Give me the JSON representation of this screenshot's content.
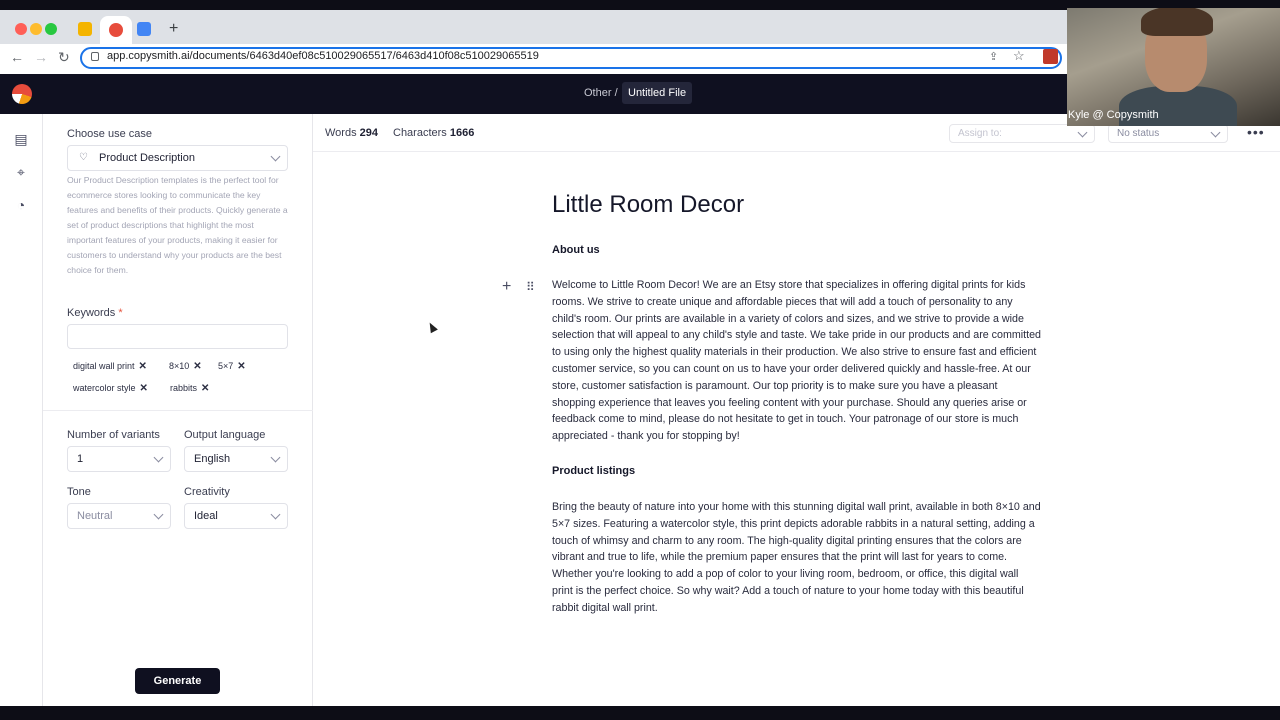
{
  "browser": {
    "url": "app.copysmith.ai/documents/6463d40ef08c510029065517/6463d410f08c510029065519"
  },
  "header": {
    "breadcrumb_parent": "Other /",
    "file_name": "Untitled File"
  },
  "sidebar": {
    "use_case_label": "Choose use case",
    "use_case_value": "Product Description",
    "help_text": "Our Product Description templates is the perfect tool for ecommerce stores looking to communicate the key features and benefits of their products. Quickly generate a set of product descriptions that highlight the most important features of your products, making it easier for customers to understand why your products are the best choice for them.",
    "keywords_label": "Keywords",
    "keywords_required_mark": "*",
    "keywords": [
      "digital wall print",
      "8×10",
      "5×7",
      "watercolor style",
      "rabbits"
    ],
    "variants_label": "Number of variants",
    "variants_value": "1",
    "language_label": "Output language",
    "language_value": "English",
    "tone_label": "Tone",
    "tone_value": "Neutral",
    "creativity_label": "Creativity",
    "creativity_value": "Ideal",
    "generate_label": "Generate"
  },
  "topbar": {
    "words_label": "Words",
    "words_value": "294",
    "chars_label": "Characters",
    "chars_value": "1666",
    "assign_placeholder": "Assign to:",
    "status_value": "No status"
  },
  "document": {
    "title": "Little Room Decor",
    "section1_heading": "About us",
    "section1_body": "Welcome to Little Room Decor! We are an Etsy store that specializes in offering digital prints for kids rooms. We strive to create unique and affordable pieces that will add a touch of personality to any child's room. Our prints are available in a variety of colors and sizes, and we strive to provide a wide selection that will appeal to any child's style and taste. We take pride in our products and are committed to using only the highest quality materials in their production. We also strive to ensure fast and efficient customer service, so you can count on us to have your order delivered quickly and hassle-free. At our store, customer satisfaction is paramount. Our top priority is to make sure you have a pleasant shopping experience that leaves you feeling content with your purchase. Should any queries arise or feedback come to mind, please do not hesitate to get in touch. Your patronage of our store is much appreciated - thank you for stopping by!",
    "section2_heading": "Product listings",
    "section2_body": "Bring the beauty of nature into your home with this stunning digital wall print, available in both 8×10 and 5×7 sizes. Featuring a watercolor style, this print depicts adorable rabbits in a natural setting, adding a touch of whimsy and charm to any room. The high-quality digital printing ensures that the colors are vibrant and true to life, while the premium paper ensures that the print will last for years to come. Whether you're looking to add a pop of color to your living room, bedroom, or office, this digital wall print is the perfect choice. So why wait? Add a touch of nature to your home today with this beautiful rabbit digital wall print."
  },
  "webcam": {
    "label": "Kyle @ Copysmith"
  },
  "colors": {
    "header_bg": "#0f1020",
    "accent": "#1a73e8"
  }
}
